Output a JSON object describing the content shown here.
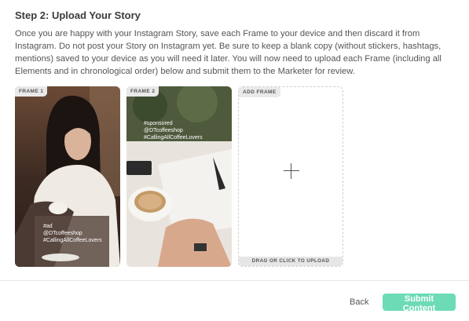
{
  "step": {
    "title": "Step 2: Upload Your Story",
    "description": "Once you are happy with your Instagram Story, save each Frame to your device and then discard it from Instagram. Do not post your Story on Instagram yet. Be sure to keep a blank copy (without stickers, hashtags, mentions) saved to your device as you will need it later. You will now need to upload each Frame (including all Elements and in chronological order) below and submit them to the Marketer for review."
  },
  "frames": [
    {
      "label": "FRAME 1",
      "lines": [
        "#ad",
        "@DTcoffeeshop",
        "#CallingAllCoffeeLovers"
      ]
    },
    {
      "label": "FRAME 2",
      "lines": [
        "#sponsored",
        "@DTcoffeeshop",
        "#CallingAllCoffeeLovers"
      ]
    }
  ],
  "add_frame": {
    "label": "ADD FRAME",
    "upload_text": "DRAG OR CLICK TO UPLOAD",
    "icon": "plus-icon"
  },
  "footer": {
    "back_label": "Back",
    "submit_label": "Submit Content",
    "submit_color": "#6ddbb6"
  }
}
